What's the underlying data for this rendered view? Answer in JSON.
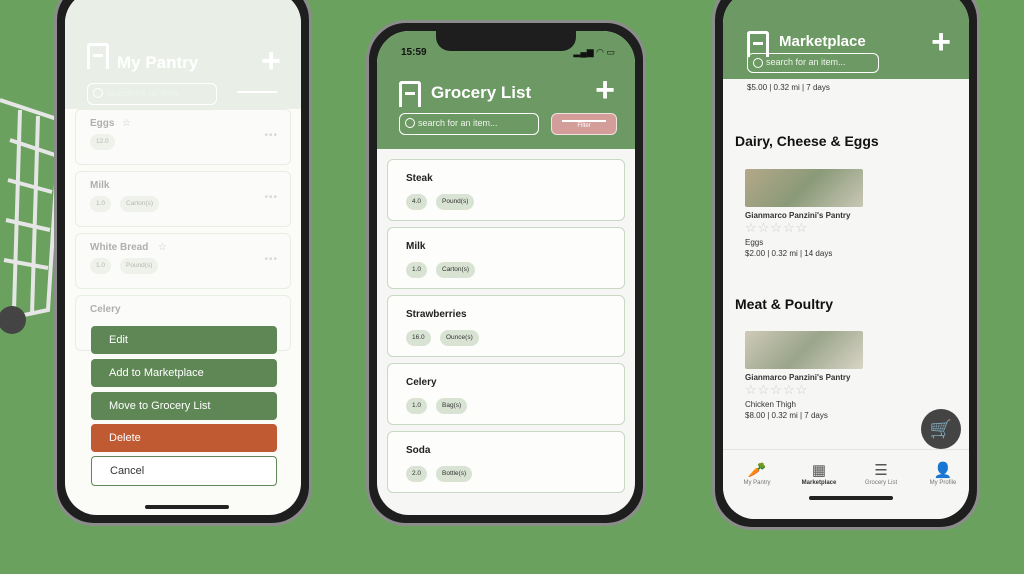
{
  "colors": {
    "background": "#6aa15e",
    "header": "#6d9a64",
    "delete": "#c05a32",
    "action": "#5f8755"
  },
  "pantry": {
    "title": "My Pantry",
    "search_placeholder": "search for an item...",
    "items": [
      {
        "name": "Eggs",
        "chip1": "12.0",
        "chip2": "",
        "star": "☆"
      },
      {
        "name": "Milk",
        "chip1": "1.0",
        "chip2": "Carton(s)",
        "star": ""
      },
      {
        "name": "White Bread",
        "chip1": "1.0",
        "chip2": "Pound(s)",
        "star": "☆"
      },
      {
        "name": "Celery",
        "chip1": "",
        "chip2": "",
        "star": ""
      }
    ],
    "more_icon": "ellipsis-icon",
    "actions": {
      "edit": "Edit",
      "add_to_marketplace": "Add to Marketplace",
      "move_to_grocery": "Move to Grocery List",
      "delete": "Delete",
      "cancel": "Cancel"
    }
  },
  "grocery": {
    "status_time": "15:59",
    "title": "Grocery List",
    "search_placeholder": "search for an item...",
    "filter_label": "Filter",
    "items": [
      {
        "name": "Steak",
        "qty": "4.0",
        "unit": "Pound(s)"
      },
      {
        "name": "Milk",
        "qty": "1.0",
        "unit": "Carton(s)"
      },
      {
        "name": "Strawberries",
        "qty": "16.0",
        "unit": "Ounce(s)"
      },
      {
        "name": "Celery",
        "qty": "1.0",
        "unit": "Bag(s)"
      },
      {
        "name": "Soda",
        "qty": "2.0",
        "unit": "Bottle(s)"
      }
    ]
  },
  "marketplace": {
    "title": "Marketplace",
    "search_placeholder": "search for an item...",
    "top_detail": "$5.00 | 0.32 mi | 7 days",
    "sections": [
      {
        "title": "Dairy, Cheese & Eggs",
        "owner": "Gianmarco Panzini's Pantry",
        "item": "Eggs",
        "detail": "$2.00 | 0.32 mi | 14 days"
      },
      {
        "title": "Meat & Poultry",
        "owner": "Gianmarco Panzini's Pantry",
        "item": "Chicken Thigh",
        "detail": "$8.00 | 0.32 mi | 7 days"
      }
    ],
    "stars": "☆☆☆☆☆",
    "tabs": [
      {
        "label": "My Pantry",
        "icon": "carrot-icon"
      },
      {
        "label": "Marketplace",
        "icon": "store-icon"
      },
      {
        "label": "Grocery List",
        "icon": "list-icon"
      },
      {
        "label": "My Profile",
        "icon": "user-icon"
      }
    ]
  }
}
